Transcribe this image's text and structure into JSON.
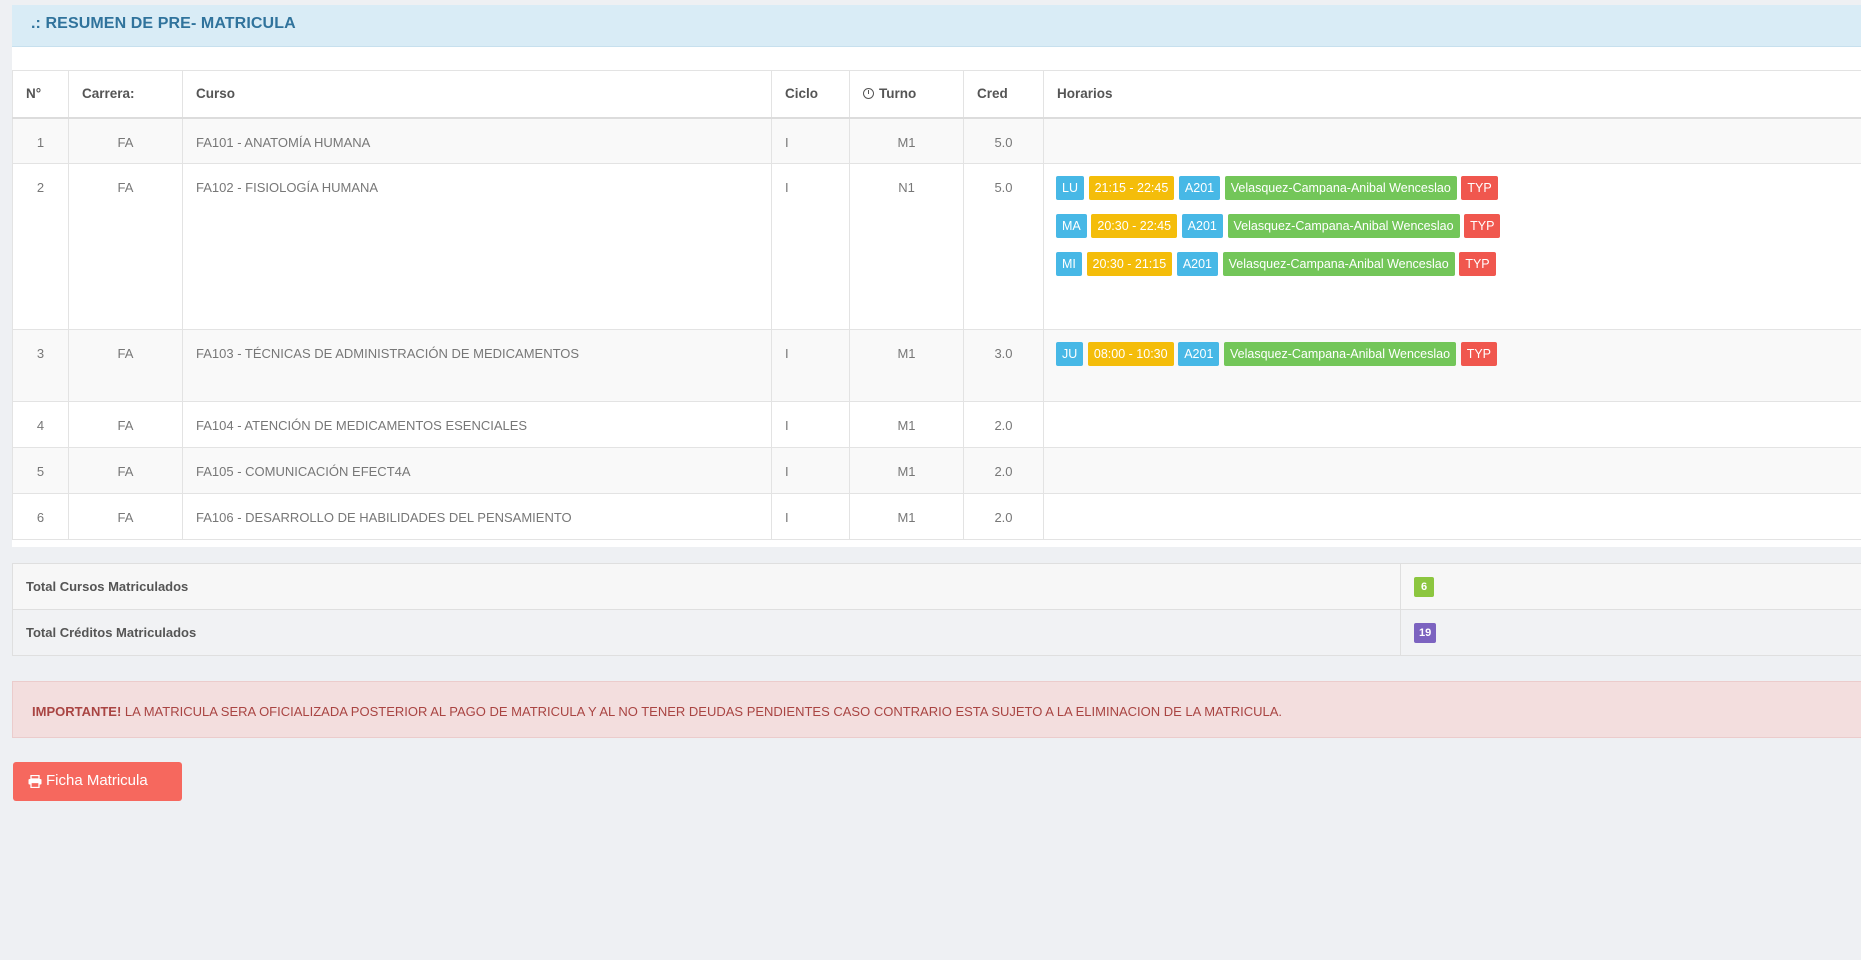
{
  "panel": {
    "title": ".: RESUMEN DE PRE- MATRICULA"
  },
  "courses": {
    "headers": {
      "n": "N°",
      "carrera": "Carrera:",
      "curso": "Curso",
      "ciclo": "Ciclo",
      "turno": "Turno",
      "cred": "Cred",
      "horarios": "Horarios"
    },
    "rows": [
      {
        "n": "1",
        "carrera": "FA",
        "curso": "FA101 - ANATOMÍA HUMANA",
        "ciclo": "I",
        "turno": "M1",
        "cred": "5.0",
        "horarios": []
      },
      {
        "n": "2",
        "carrera": "FA",
        "curso": "FA102 - FISIOLOGÍA HUMANA",
        "ciclo": "I",
        "turno": "N1",
        "cred": "5.0",
        "horarios": [
          {
            "day": "LU",
            "time": "21:15 - 22:45",
            "room": "A201",
            "teacher": "Velasquez-Campana-Anibal Wenceslao",
            "type": "TYP"
          },
          {
            "day": "MA",
            "time": "20:30 - 22:45",
            "room": "A201",
            "teacher": "Velasquez-Campana-Anibal Wenceslao",
            "type": "TYP"
          },
          {
            "day": "MI",
            "time": "20:30 - 21:15",
            "room": "A201",
            "teacher": "Velasquez-Campana-Anibal Wenceslao",
            "type": "TYP"
          }
        ]
      },
      {
        "n": "3",
        "carrera": "FA",
        "curso": "FA103 - TÉCNICAS DE ADMINISTRACIÓN DE MEDICAMENTOS",
        "ciclo": "I",
        "turno": "M1",
        "cred": "3.0",
        "horarios": [
          {
            "day": "JU",
            "time": "08:00 - 10:30",
            "room": "A201",
            "teacher": "Velasquez-Campana-Anibal Wenceslao",
            "type": "TYP"
          }
        ]
      },
      {
        "n": "4",
        "carrera": "FA",
        "curso": "FA104 - ATENCIÓN DE MEDICAMENTOS ESENCIALES",
        "ciclo": "I",
        "turno": "M1",
        "cred": "2.0",
        "horarios": []
      },
      {
        "n": "5",
        "carrera": "FA",
        "curso": "FA105 - COMUNICACIÓN EFECT4A",
        "ciclo": "I",
        "turno": "M1",
        "cred": "2.0",
        "horarios": []
      },
      {
        "n": "6",
        "carrera": "FA",
        "curso": "FA106 - DESARROLLO DE HABILIDADES DEL PENSAMIENTO",
        "ciclo": "I",
        "turno": "M1",
        "cred": "2.0",
        "horarios": []
      }
    ]
  },
  "totals": {
    "cursos_label": "Total Cursos Matriculados",
    "cursos_value": "6",
    "creditos_label": "Total Créditos Matriculados",
    "creditos_value": "19"
  },
  "alert": {
    "strong": "IMPORTANTE!",
    "text": " LA MATRICULA SERA OFICIALIZADA POSTERIOR AL PAGO DE MATRICULA Y AL NO TENER DEUDAS PENDIENTES CASO CONTRARIO ESTA SUJETO A LA ELIMINACION DE LA MATRICULA."
  },
  "button": {
    "label": "Ficha Matricula",
    "icon": "printer-icon"
  },
  "colors": {
    "header_bg": "#d9ecf6",
    "title": "#30739c",
    "chip_day": "#47b8e6",
    "chip_time": "#f4bd0a",
    "chip_teacher": "#73c659",
    "chip_type": "#f0574e",
    "badge_cursos": "#8cc63f",
    "badge_creditos": "#7c63c0",
    "alert_bg": "#f3dede",
    "button_bg": "#f6685e"
  }
}
